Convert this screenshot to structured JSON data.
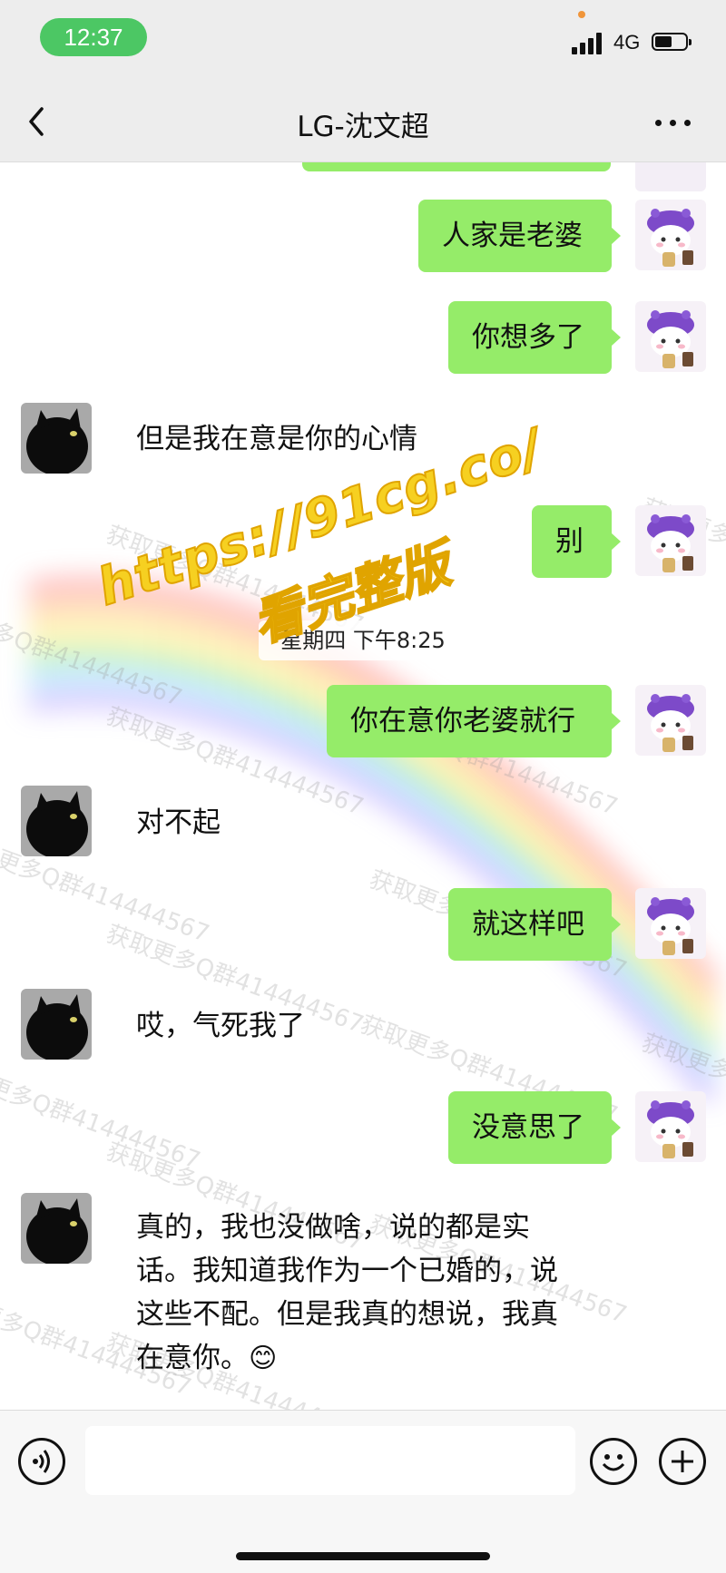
{
  "status_bar": {
    "time": "12:37",
    "network": "4G",
    "battery_level": 0.55
  },
  "nav": {
    "title": "LG-沈文超"
  },
  "messages": [
    {
      "side": "right",
      "text": "人家是老婆"
    },
    {
      "side": "right",
      "text": "你想多了"
    },
    {
      "side": "left",
      "text": "但是我在意是你的心情"
    },
    {
      "side": "right",
      "text": "别"
    },
    {
      "side": "right",
      "text": "你在意你老婆就行"
    },
    {
      "side": "left",
      "text": "对不起"
    },
    {
      "side": "right",
      "text": "就这样吧"
    },
    {
      "side": "left",
      "text": "哎，气死我了"
    },
    {
      "side": "right",
      "text": "没意思了"
    },
    {
      "side": "left",
      "lines": [
        "真的，我也没做啥，说的都是实",
        "话。我知道我作为一个已婚的，说",
        "这些不配。但是我真的想说，我真",
        "在意你。"
      ],
      "emoji": "😊"
    }
  ],
  "timestamp": "星期四 下午8:25",
  "overlay": {
    "url": "https://91cg.co/",
    "sub": "看完整版",
    "qq_watermark": "获取更多Q群414444567"
  },
  "colors": {
    "sent_bubble": "#95ec69",
    "time_pill": "#4cc764",
    "chat_bg": "#ffffff",
    "bar_bg": "#ededed"
  },
  "icons": {
    "voice": "voice-icon",
    "emoji": "emoji-icon",
    "plus": "plus-icon",
    "back": "back-chevron-icon",
    "more": "more-dots-icon"
  }
}
